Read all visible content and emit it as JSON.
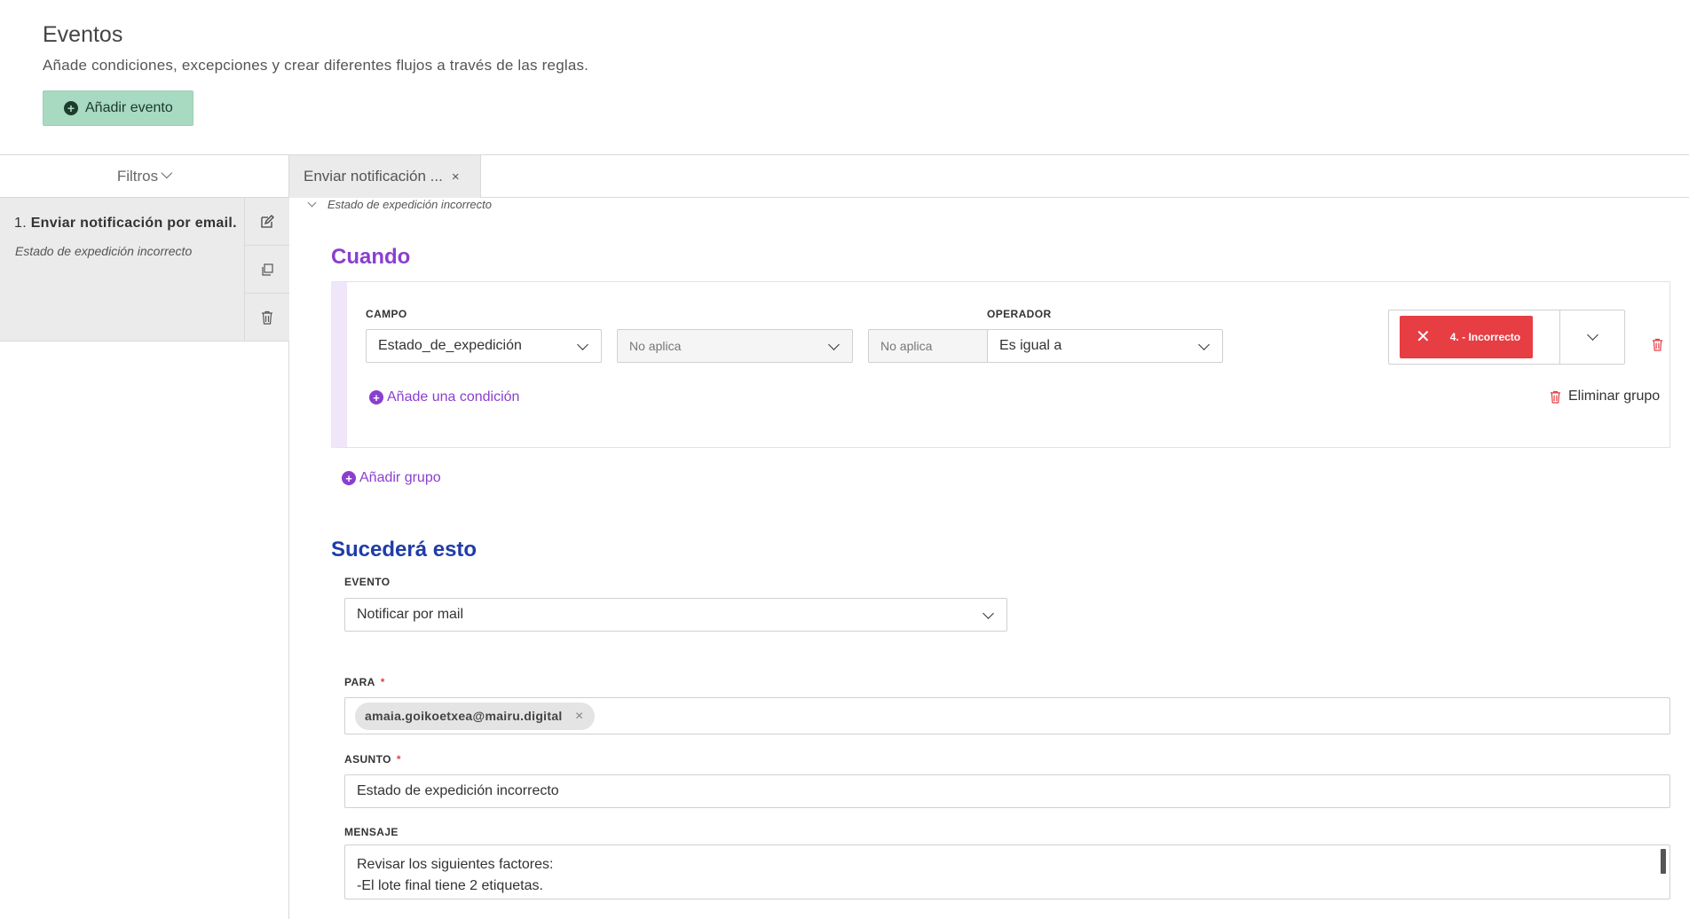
{
  "header": {
    "title": "Eventos",
    "subtitle": "Añade condiciones, excepciones y crear diferentes flujos a través de las reglas.",
    "add_button_label": "Añadir evento"
  },
  "sidebar": {
    "filters_label": "Filtros",
    "rules": [
      {
        "number": "1.",
        "name": "Enviar notificación por email.",
        "description": "Estado de expedición incorrecto"
      }
    ]
  },
  "tabs": [
    {
      "label": "Enviar notificación ..."
    }
  ],
  "rule_detail": {
    "breadcrumb": "Estado de expedición incorrecto",
    "when": {
      "title": "Cuando",
      "campo_label": "CAMPO",
      "operador_label": "OPERADOR",
      "field_value": "Estado_de_expedición",
      "sub1_value": "No aplica",
      "sub2_value": "No aplica",
      "operator_value": "Es igual a",
      "selected_value": "4. - Incorrecto",
      "add_condition_label": "Añade una condición",
      "delete_group_label": "Eliminar grupo",
      "add_group_label": "Añadir grupo"
    },
    "then": {
      "title": "Sucederá esto",
      "evento_label": "EVENTO",
      "evento_value": "Notificar por mail",
      "para_label": "PARA",
      "required_mark": "*",
      "para_chips": [
        "amaia.goikoetxea@mairu.digital"
      ],
      "asunto_label": "ASUNTO",
      "asunto_value": "Estado de expedición incorrecto",
      "mensaje_label": "MENSAJE",
      "mensaje_lines": [
        "Revisar los siguientes factores:",
        "-El lote final tiene 2 etiquetas."
      ]
    }
  },
  "colors": {
    "accent_green": "#a8d9c1",
    "when_purple": "#8a3fcf",
    "then_blue": "#1f3ca8",
    "danger_red": "#e63e43"
  }
}
